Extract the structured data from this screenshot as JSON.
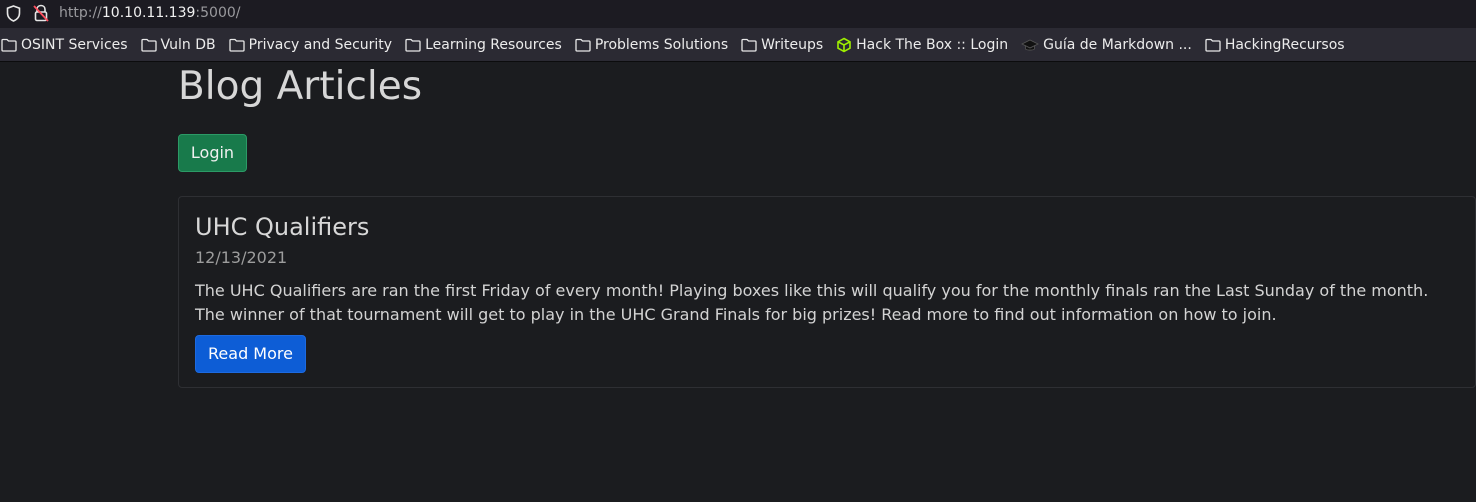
{
  "browser": {
    "url_scheme": "http://",
    "url_host": "10.10.11.139",
    "url_rest": ":5000/",
    "icons": [
      "shield-icon",
      "lock-slash-icon"
    ]
  },
  "bookmarks": [
    {
      "label": "OSINT Services",
      "icon": "folder-icon"
    },
    {
      "label": "Vuln DB",
      "icon": "folder-icon"
    },
    {
      "label": "Privacy and Security",
      "icon": "folder-icon"
    },
    {
      "label": "Learning Resources",
      "icon": "folder-icon"
    },
    {
      "label": "Problems Solutions",
      "icon": "folder-icon"
    },
    {
      "label": "Writeups",
      "icon": "folder-icon"
    },
    {
      "label": "Hack The Box :: Login",
      "icon": "htb-cube-icon"
    },
    {
      "label": "Guía de Markdown ...",
      "icon": "graduation-cap-icon"
    },
    {
      "label": "HackingRecursos",
      "icon": "folder-icon"
    }
  ],
  "page": {
    "title": "Blog Articles",
    "login_label": "Login"
  },
  "articles": [
    {
      "title": "UHC Qualifiers",
      "date": "12/13/2021",
      "body": "The UHC Qualifiers are ran the first Friday of every month! Playing boxes like this will qualify you for the monthly finals ran the Last Sunday of the month. The winner of that tournament will get to play in the UHC Grand Finals for big prizes! Read more to find out information on how to join.",
      "button_label": "Read More"
    }
  ],
  "colors": {
    "background": "#1b1c1f",
    "login_button": "#187a4b",
    "read_more_button": "#0d5dd6",
    "htb_icon": "#9fef00"
  }
}
